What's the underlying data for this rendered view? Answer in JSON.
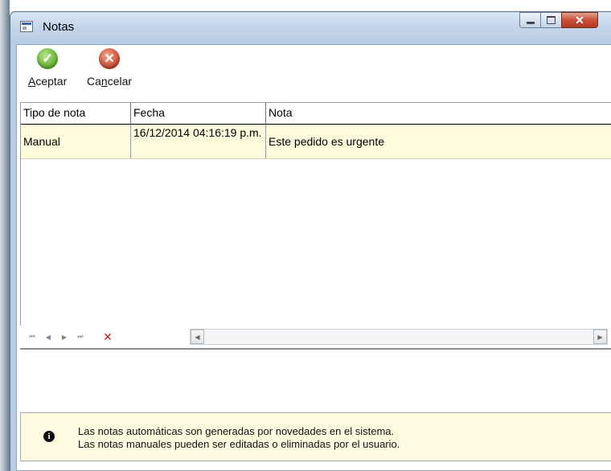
{
  "window": {
    "title": "Notas"
  },
  "toolbar": {
    "accept_pre": "",
    "accept_key": "A",
    "accept_post": "ceptar",
    "cancel_pre": "Ca",
    "cancel_key": "n",
    "cancel_post": "celar"
  },
  "grid": {
    "columns": [
      "Tipo de nota",
      "Fecha",
      "Nota"
    ],
    "rows": [
      {
        "tipo": "Manual",
        "fecha": "16/12/2014 04:16:19 p.m.",
        "nota": "Este pedido es urgente"
      }
    ]
  },
  "navigator": {
    "buttons": [
      "first-icon",
      "prev-icon",
      "next-icon",
      "last-icon",
      "delete-icon"
    ]
  },
  "info": {
    "line1": "Las notas automáticas son generadas por novedades en el sistema.",
    "line2": "Las notas manuales pueden ser editadas o eliminadas por el usuario."
  },
  "colors": {
    "selected_row": "#fdfbdc",
    "info_background": "#fefbe0",
    "accept": "#5fae2b",
    "cancel": "#c9452a",
    "close_button": "#c8503a"
  }
}
